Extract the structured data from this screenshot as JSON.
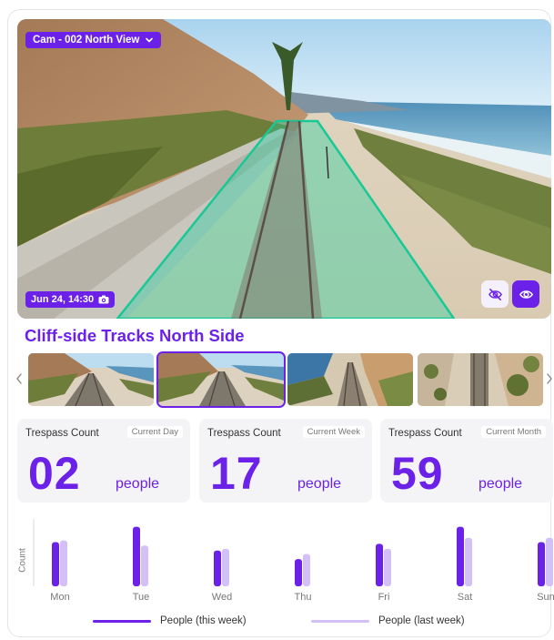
{
  "camera": {
    "selector_label": "Cam - 002 North View",
    "timestamp": "Jun 24, 14:30"
  },
  "location_title": "Cliff-side Tracks North Side",
  "thumbnails": [
    {
      "name": "thumb-1",
      "selected": false
    },
    {
      "name": "thumb-2",
      "selected": true
    },
    {
      "name": "thumb-3",
      "selected": false
    },
    {
      "name": "thumb-4",
      "selected": false
    }
  ],
  "stats": [
    {
      "label": "Trespass Count",
      "period": "Current Day",
      "value": "02",
      "unit": "people"
    },
    {
      "label": "Trespass Count",
      "period": "Current Week",
      "value": "17",
      "unit": "people"
    },
    {
      "label": "Trespass Count",
      "period": "Current Month",
      "value": "59",
      "unit": "people"
    }
  ],
  "colors": {
    "accent": "#6b21e8",
    "this_week": "#6b21e8",
    "last_week": "#d2c0f7",
    "zone": "#1ed3a0"
  },
  "chart_data": {
    "type": "bar",
    "ylabel": "Count",
    "categories": [
      "Mon",
      "Tue",
      "Wed",
      "Thu",
      "Fri",
      "Sat",
      "Sun"
    ],
    "series": [
      {
        "name": "People (this week)",
        "values": [
          5.2,
          7.0,
          4.2,
          3.2,
          5.0,
          7.0,
          5.2
        ]
      },
      {
        "name": "People (last week)",
        "values": [
          5.4,
          4.8,
          4.4,
          3.8,
          4.4,
          5.7,
          5.7
        ]
      }
    ],
    "ylim": [
      0,
      7.5
    ],
    "grid": false,
    "legend": "bottom"
  }
}
